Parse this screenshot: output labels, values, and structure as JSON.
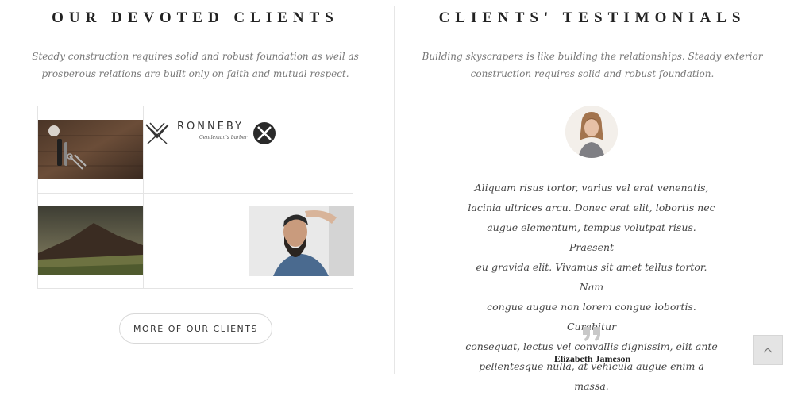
{
  "clients_section": {
    "title": "OUR DEVOTED CLIENTS",
    "subtitle_line1": "Steady construction requires solid and robust foundation as well as",
    "subtitle_line2": "prosperous relations are built only on faith and mutual respect.",
    "logos": [
      {
        "name": "RONNEBY",
        "tagline": "Gentleman's barber"
      }
    ],
    "more_button_label": "MORE OF OUR CLIENTS"
  },
  "testimonials_section": {
    "title": "CLIENTS' TESTIMONIALS",
    "subtitle_line1": "Building skyscrapers is like building the relationships. Steady exterior",
    "subtitle_line2": "construction requires solid and robust foundation.",
    "testimonial": {
      "lines": [
        "Aliquam risus tortor, varius vel erat venenatis,",
        "lacinia ultrices arcu. Donec erat elit, lobortis nec",
        "augue elementum, tempus volutpat risus. Praesent",
        "eu gravida elit. Vivamus sit amet tellus tortor. Nam",
        "congue augue non lorem congue lobortis. Curabitur",
        "consequat, lectus vel convallis dignissim, elit ante",
        "pellentesque nulla, at vehicula augue enim a massa."
      ],
      "author": "Elizabeth Jameson"
    }
  },
  "icons": {
    "quote": "quote-icon",
    "back_to_top": "chevron-up-icon"
  }
}
